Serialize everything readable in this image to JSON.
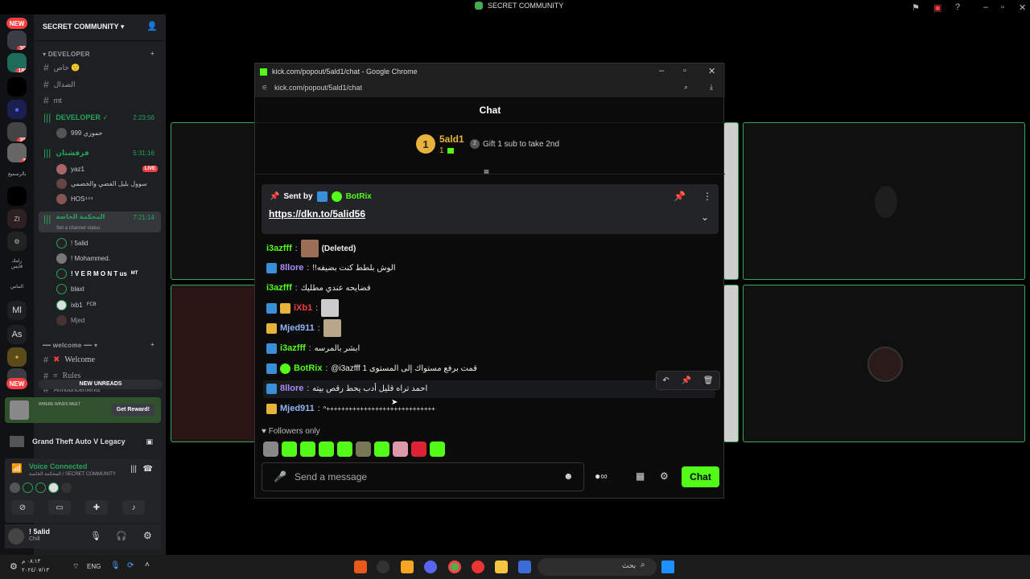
{
  "window_title": "SECRET COMMUNITY",
  "server_rail": {
    "new_badge": "NEW",
    "badges": [
      "30",
      "188",
      "35",
      "2"
    ],
    "labels": [
      "بالرسميح",
      "زي",
      "رامك فايس",
      "الماس",
      "Ml",
      "As"
    ]
  },
  "sidebar": {
    "server_name": "SECRET COMMUNITY",
    "category_developer": "DEVELOPER",
    "channels": [
      "خاص 🙂",
      "الصدال",
      "mt"
    ],
    "voice1": {
      "name": "DEVELOPER ✓",
      "time": "2:23:56",
      "user": "حموزي 999"
    },
    "voice2": {
      "name": "فرفشتان",
      "time": "5:31:16",
      "users": [
        "yaz1",
        "سوول بليل الفضي والخصمي",
        "HOS⁴⁴⁴"
      ],
      "live": "LIVE"
    },
    "voice3": {
      "name": "المحكمة الخاصة",
      "time": "7:21:14",
      "status": "Set a channel status",
      "users": [
        "! 5alid",
        "! Mohammed.",
        "! V E R M O N T us",
        "blaxt",
        "ixb1",
        "Mjed"
      ],
      "user_tags": [
        "",
        "",
        "MT",
        "",
        "FCB",
        ""
      ]
    },
    "category_welcome": "welcome",
    "welcome_channel": "Welcome",
    "rules_channel": "Rules",
    "announcements_channel": "Announcements",
    "new_unreads": "NEW UNREADS",
    "promo": {
      "text": "WHERE WINDS MEET",
      "button": "Get Reward!"
    },
    "game": "Grand Theft Auto V Legacy",
    "voice_connected": "Voice Connected",
    "voice_path": "المحكمة الخاصة / SECRET COMMUNITY",
    "me": {
      "name": "! 5alid",
      "status": "Chill"
    }
  },
  "popup": {
    "title": "kick.com/popout/5ald1/chat - Google Chrome",
    "url": "kick.com/popout/5ald1/chat",
    "chat_header": "Chat",
    "top_gifter": {
      "rank": "1",
      "name": "5ald1",
      "count": "1",
      "gift_rank": "2",
      "gift_text": "Gift 1 sub to take 2nd"
    },
    "pinned": {
      "sent_by": "Sent by",
      "user": "BotRix",
      "link": "https://dkn.to/5alid56"
    },
    "messages": [
      {
        "user": "i3azfff",
        "text": "(Deleted)",
        "color": "#53fc18"
      },
      {
        "user": "8llore",
        "text": "!!الوش بلطط كنت بضيفه",
        "color": "#a88cf3"
      },
      {
        "user": "i3azfff",
        "text": "فضايحه عندي مطليك",
        "color": "#53fc18"
      },
      {
        "user": "iXb1",
        "text": "",
        "color": "#f23f43"
      },
      {
        "user": "Mjed911",
        "text": "",
        "color": "#93b4f5"
      },
      {
        "user": "i3azfff",
        "text": "ابشر بالمرسه",
        "color": "#53fc18"
      },
      {
        "user": "BotRix",
        "text": "@i3azfff قمت برفع مستواك إلى المستوى 1",
        "color": "#53fc18"
      },
      {
        "user": "8llore",
        "text": "احمد تراه قليل أدب يحط رقص بيته",
        "color": "#a88cf3"
      },
      {
        "user": "Mjed911",
        "text": "^+++++++++++++++++++++++++++++",
        "color": "#93b4f5"
      }
    ],
    "followers_only": "Followers only",
    "input_placeholder": "Send a message",
    "chat_button": "Chat"
  },
  "taskbar": {
    "time": "٠٨:١٣ م",
    "date": "٢٠٢٤/٠٧/١٣",
    "lang": "ENG",
    "search_placeholder": "بحث"
  },
  "accent_colors": {
    "kick_green": "#53fc18",
    "discord_green": "#23a55a",
    "live_red": "#f23f43"
  }
}
